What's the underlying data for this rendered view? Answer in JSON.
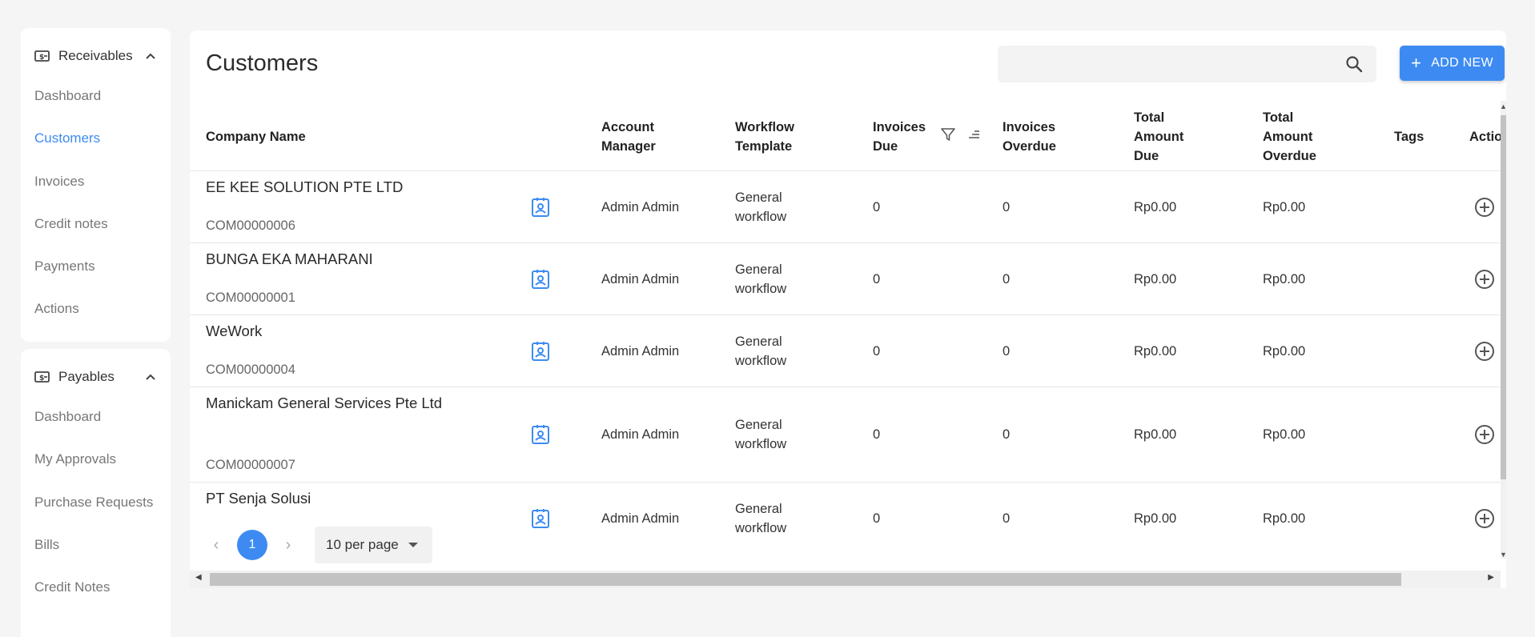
{
  "sidebar": {
    "receivables": {
      "title": "Receivables",
      "items": [
        {
          "label": "Dashboard"
        },
        {
          "label": "Customers"
        },
        {
          "label": "Invoices"
        },
        {
          "label": "Credit notes"
        },
        {
          "label": "Payments"
        },
        {
          "label": "Actions"
        }
      ]
    },
    "payables": {
      "title": "Payables",
      "items": [
        {
          "label": "Dashboard"
        },
        {
          "label": "My Approvals"
        },
        {
          "label": "Purchase Requests"
        },
        {
          "label": "Bills"
        },
        {
          "label": "Credit Notes"
        }
      ]
    }
  },
  "header": {
    "title": "Customers",
    "search_placeholder": "",
    "add_label": "ADD NEW"
  },
  "table": {
    "columns": {
      "company": "Company Name",
      "manager": "Account Manager",
      "workflow": "Workflow Template",
      "inv_due": "Invoices Due",
      "inv_overdue": "Invoices Overdue",
      "amt_due": "Total Amount Due",
      "amt_overdue": "Total Amount Overdue",
      "tags": "Tags",
      "actions": "Actio"
    },
    "rows": [
      {
        "name": "EE KEE SOLUTION PTE LTD",
        "code": "COM00000006",
        "manager": "Admin Admin",
        "workflow": "General workflow",
        "inv_due": "0",
        "inv_overdue": "0",
        "amt_due": "Rp0.00",
        "amt_overdue": "Rp0.00"
      },
      {
        "name": "BUNGA EKA MAHARANI",
        "code": "COM00000001",
        "manager": "Admin Admin",
        "workflow": "General workflow",
        "inv_due": "0",
        "inv_overdue": "0",
        "amt_due": "Rp0.00",
        "amt_overdue": "Rp0.00"
      },
      {
        "name": "WeWork",
        "code": "COM00000004",
        "manager": "Admin Admin",
        "workflow": "General workflow",
        "inv_due": "0",
        "inv_overdue": "0",
        "amt_due": "Rp0.00",
        "amt_overdue": "Rp0.00"
      },
      {
        "name": "Manickam General Services Pte Ltd",
        "code": "COM00000007",
        "manager": "Admin Admin",
        "workflow": "General workflow",
        "inv_due": "0",
        "inv_overdue": "0",
        "amt_due": "Rp0.00",
        "amt_overdue": "Rp0.00"
      },
      {
        "name": "PT Senja Solusi",
        "code": "",
        "manager": "Admin Admin",
        "workflow": "General workflow",
        "inv_due": "0",
        "inv_overdue": "0",
        "amt_due": "Rp0.00",
        "amt_overdue": "Rp0.00"
      }
    ]
  },
  "pagination": {
    "current_page": "1",
    "per_page": "10 per page"
  },
  "icons": {
    "sidebar_receivables": "money-icon",
    "sidebar_payables": "money-icon",
    "collapse": "chevron-up-icon",
    "search": "search-icon",
    "add": "plus-icon",
    "filter": "filter-icon",
    "sort": "sort-icon",
    "contact": "contact-card-icon",
    "action": "add-circle-icon"
  },
  "colors": {
    "accent": "#3d8bf2",
    "background": "#f5f5f5"
  }
}
